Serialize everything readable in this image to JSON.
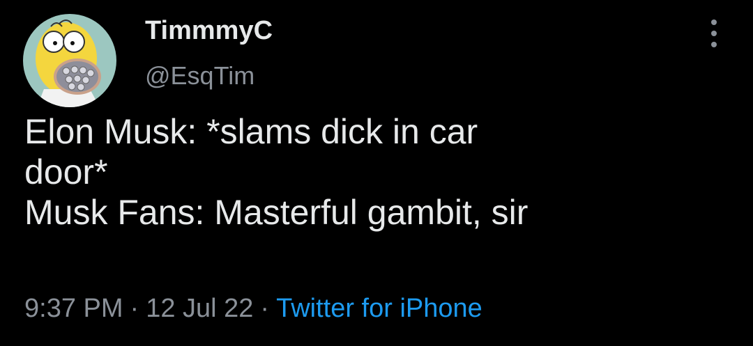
{
  "author": {
    "display_name": "TimmmyC",
    "handle": "@EsqTim",
    "avatar": "homer-simpson-avatar"
  },
  "menu": {
    "icon": "more-vertical-icon"
  },
  "tweet": {
    "lines": [
      "Elon Musk: *slams dick in car",
      "door*",
      "Musk Fans: Masterful gambit, sir"
    ]
  },
  "meta": {
    "time": "9:37 PM",
    "separator": "·",
    "date": "12 Jul 22",
    "source": "Twitter for iPhone"
  },
  "colors": {
    "background": "#000000",
    "primary_text": "#e7e9ea",
    "secondary_text": "#8b9199",
    "link": "#1d9bf0"
  }
}
